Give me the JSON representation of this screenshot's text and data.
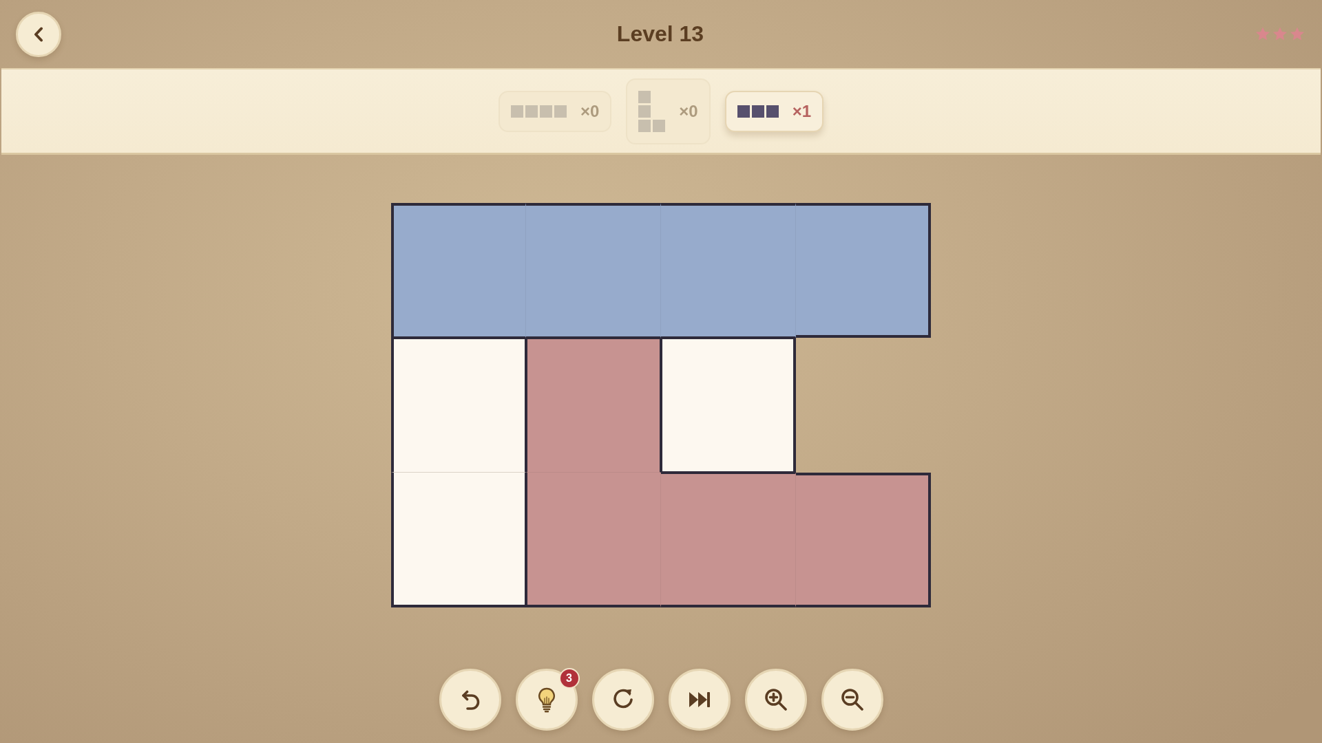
{
  "header": {
    "title": "Level 13",
    "stars": 3
  },
  "pieces": [
    {
      "kind": "bar4",
      "count": "×0",
      "disabled": true
    },
    {
      "kind": "ell",
      "count": "×0",
      "disabled": true
    },
    {
      "kind": "bar3",
      "count": "×1",
      "disabled": false
    }
  ],
  "board": {
    "rows": [
      {
        "cells": [
          {
            "kind": "filled",
            "color": "#97abcc"
          },
          {
            "kind": "filled",
            "color": "#97abcc"
          },
          {
            "kind": "filled",
            "color": "#97abcc"
          },
          {
            "kind": "filled",
            "color": "#97abcc"
          }
        ]
      },
      {
        "cells": [
          {
            "kind": "empty"
          },
          {
            "kind": "filled",
            "color": "#c79391"
          },
          {
            "kind": "empty"
          },
          {
            "kind": "void"
          }
        ]
      },
      {
        "cells": [
          {
            "kind": "empty"
          },
          {
            "kind": "filled",
            "color": "#c79391"
          },
          {
            "kind": "filled",
            "color": "#c79391"
          },
          {
            "kind": "filled",
            "color": "#c79391"
          }
        ]
      }
    ]
  },
  "toolbar": [
    {
      "kind": "undo"
    },
    {
      "kind": "hint",
      "badge": "3"
    },
    {
      "kind": "restart"
    },
    {
      "kind": "skip"
    },
    {
      "kind": "zoom_in"
    },
    {
      "kind": "zoom_out"
    }
  ]
}
